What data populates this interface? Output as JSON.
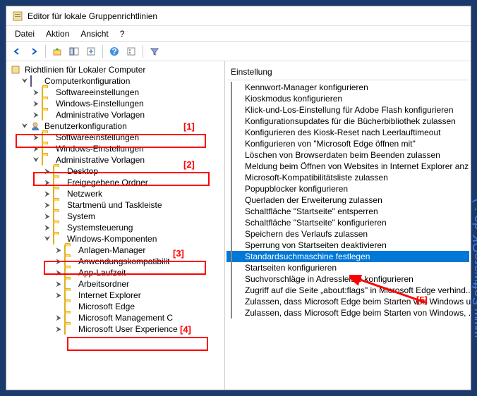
{
  "window": {
    "title": "Editor für lokale Gruppenrichtlinien"
  },
  "menu": {
    "file": "Datei",
    "action": "Aktion",
    "view": "Ansicht",
    "help": "?"
  },
  "tree": {
    "root": "Richtlinien für Lokaler Computer",
    "computer_config": "Computerkonfiguration",
    "software_settings": "Softwareeinstellungen",
    "windows_settings": "Windows-Einstellungen",
    "admin_templates": "Administrative Vorlagen",
    "user_config": "Benutzerkonfiguration",
    "desktop": "Desktop",
    "shared_folders": "Freigegebene Ordner",
    "network": "Netzwerk",
    "startmenu": "Startmenü und Taskleiste",
    "system": "System",
    "control_panel": "Systemsteuerung",
    "windows_components": "Windows-Komponenten",
    "anlagen_manager": "Anlagen-Manager",
    "app_compat": "Anwendungskompatibilit",
    "app_runtime": "App-Laufzeit",
    "work_folders": "Arbeitsordner",
    "internet_explorer": "Internet Explorer",
    "microsoft_edge": "Microsoft Edge",
    "microsoft_mgmt": "Microsoft Management C",
    "microsoft_user_exp": "Microsoft User Experience"
  },
  "list": {
    "header": "Einstellung",
    "items": [
      "Kennwort-Manager konfigurieren",
      "Kioskmodus konfigurieren",
      "Klick-und-Los-Einstellung für Adobe Flash konfigurieren",
      "Konfigurationsupdates für die Bücherbibliothek zulassen",
      "Konfigurieren des Kiosk-Reset nach Leerlauftimeout",
      "Konfigurieren von \"Microsoft Edge öffnen mit\"",
      "Löschen von Browserdaten beim Beenden zulassen",
      "Meldung beim Öffnen von Websites in Internet Explorer anz",
      "Microsoft-Kompatibilitätsliste zulassen",
      "Popupblocker konfigurieren",
      "Querladen der Erweiterung zulassen",
      "Schaltfläche \"Startseite\" entsperren",
      "Schaltfläche \"Startseite\" konfigurieren",
      "Speichern des Verlaufs zulassen",
      "Sperrung von Startseiten deaktivieren",
      "Standardsuchmaschine festlegen",
      "Startseiten konfigurieren",
      "Suchvorschläge in Adressleiste konfigurieren",
      "Zugriff auf die Seite „about:flags\" in Microsoft Edge verhind...",
      "Zulassen, dass Microsoft Edge beim Starten von Windows u...",
      "Zulassen, dass Microsoft Edge beim Starten von Windows, ..."
    ],
    "selected_index": 15
  },
  "annotations": {
    "a1": "[1]",
    "a2": "[2]",
    "a3": "[3]",
    "a4": "[4]",
    "a5": "[5]"
  },
  "watermark": "www.SoftwareOK.de :-)"
}
